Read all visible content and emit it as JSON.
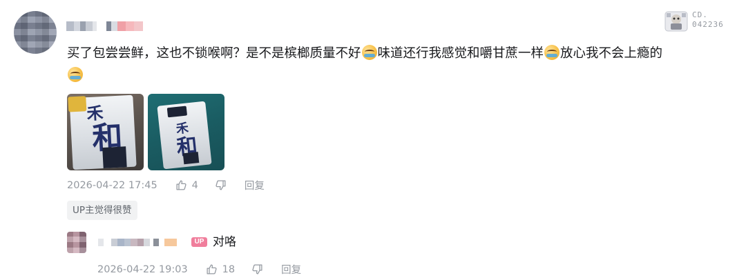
{
  "comment": {
    "author_name": "",
    "fan_badge": {
      "line1": "CD.",
      "line2": "042236"
    },
    "text_segments": [
      {
        "type": "text",
        "value": "买了包尝尝鲜，这也不锁喉啊？是不是槟榔质量不好"
      },
      {
        "type": "emoji",
        "name": "laughing-crying-emoji"
      },
      {
        "type": "text",
        "value": "味道还行我感觉和嚼甘蔗一样"
      },
      {
        "type": "emoji",
        "name": "laughing-crying-emoji"
      },
      {
        "type": "text",
        "value": "放心我不会上瘾的"
      },
      {
        "type": "emoji",
        "name": "laughing-crying-emoji"
      }
    ],
    "images": [
      {
        "desc": "betel nut package with 和 character, brown background"
      },
      {
        "desc": "betel nut package with 和 character, teal background"
      }
    ],
    "timestamp": "2026-04-22 17:45",
    "like_count": "4",
    "reply_label": "回复",
    "up_tag": "UP主觉得很赞"
  },
  "reply": {
    "author_name": "",
    "up_badge": "UP",
    "text": "对咯",
    "timestamp": "2026-04-22 19:03",
    "like_count": "18",
    "reply_label": "回复"
  },
  "colors": {
    "meta_gray": "#9499a0",
    "up_badge_pink": "#f07e9c",
    "tag_bg": "#f1f2f3",
    "text_main": "#18191c"
  }
}
